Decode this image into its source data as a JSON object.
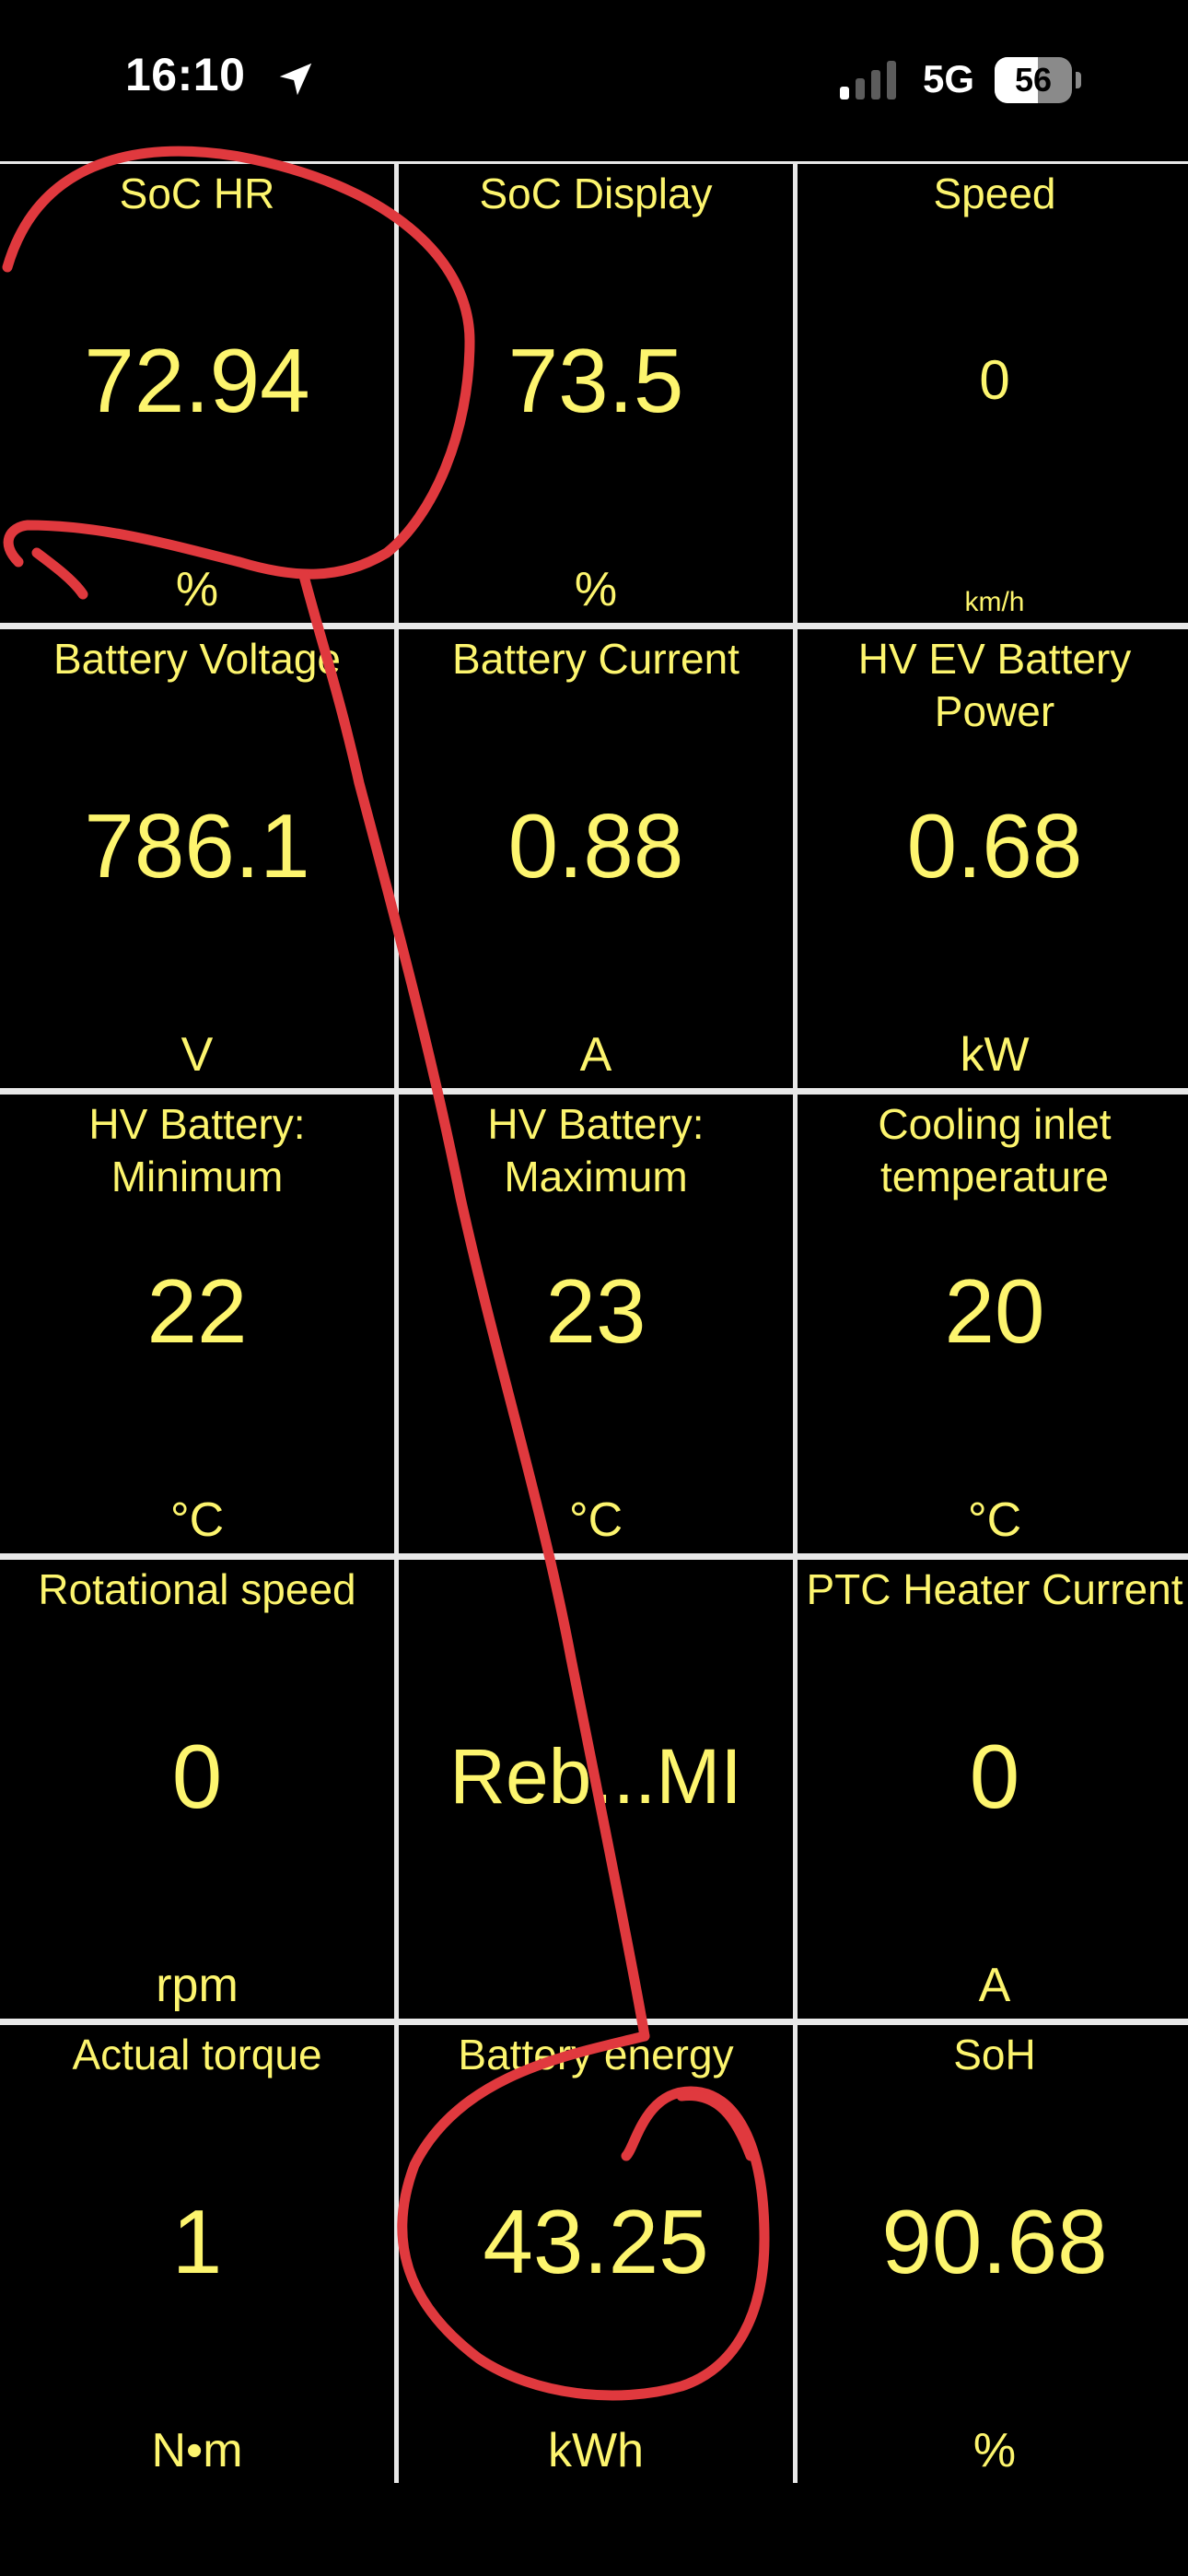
{
  "status_bar": {
    "time": "16:10",
    "network": "5G",
    "battery_level": "56",
    "battery_fraction": 0.56
  },
  "colors": {
    "accent": "#fdf56e",
    "annotation": "#e0393e",
    "background": "#000000",
    "grid_line": "#e8e8e8"
  },
  "tiles": [
    {
      "title": "SoC HR",
      "value": "72.94",
      "unit": "%"
    },
    {
      "title": "SoC Display",
      "value": "73.5",
      "unit": "%"
    },
    {
      "title": "Speed",
      "value": "0",
      "unit": "km/h"
    },
    {
      "title": "Battery Voltage",
      "value": "786.1",
      "unit": "V"
    },
    {
      "title": "Battery Current",
      "value": "0.88",
      "unit": "A"
    },
    {
      "title": "HV EV Battery Power",
      "value": "0.68",
      "unit": "kW"
    },
    {
      "title": "HV Battery: Minimum",
      "value": "22",
      "unit": "°C"
    },
    {
      "title": "HV Battery: Maximum",
      "value": "23",
      "unit": "°C"
    },
    {
      "title": "Cooling inlet temperature",
      "value": "20",
      "unit": "°C"
    },
    {
      "title": "Rotational speed",
      "value": "0",
      "unit": "rpm"
    },
    {
      "title": "",
      "value": "Reb...MI",
      "unit": ""
    },
    {
      "title": "PTC Heater Current",
      "value": "0",
      "unit": "A"
    },
    {
      "title": "Actual torque",
      "value": "1",
      "unit": "N•m"
    },
    {
      "title": "Battery energy",
      "value": "43.25",
      "unit": "kWh"
    },
    {
      "title": "SoH",
      "value": "90.68",
      "unit": "%"
    }
  ]
}
